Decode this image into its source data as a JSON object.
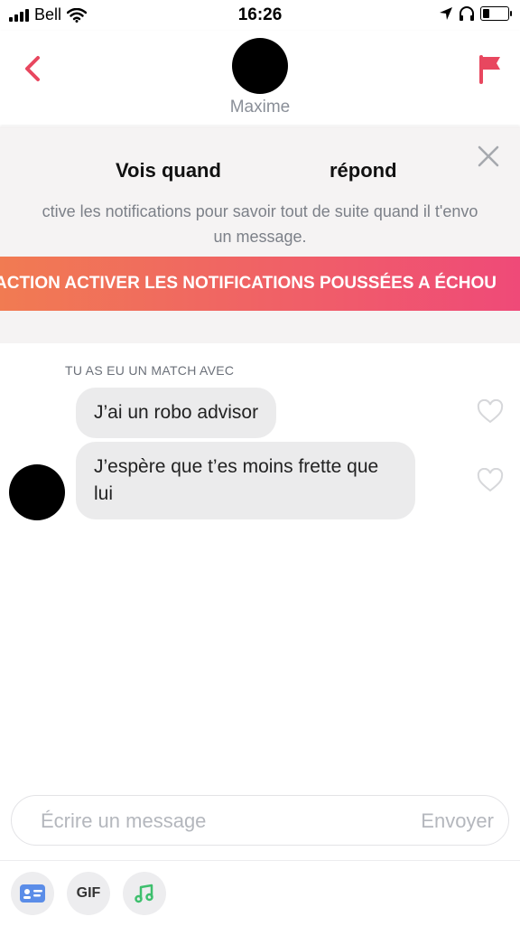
{
  "status_bar": {
    "carrier": "Bell",
    "time": "16:26"
  },
  "header": {
    "contact_name": "Maxime"
  },
  "banner": {
    "title_part1": "Vois quand",
    "title_part2": "répond",
    "description_line1": "ctive les notifications pour savoir tout de suite quand il t'envo",
    "description_line2": "un message.",
    "button_label": "ACTION ACTIVER LES NOTIFICATIONS POUSSÉES A ÉCHOU"
  },
  "chat": {
    "match_label": "TU AS EU UN MATCH AVEC",
    "messages": [
      {
        "text": "J’ai un robo advisor"
      },
      {
        "text": "J’espère que t’es moins frette que lui"
      }
    ]
  },
  "composer": {
    "placeholder": "Écrire un message",
    "send_label": "Envoyer"
  },
  "bottom_bar": {
    "gif_label": "GIF"
  },
  "colors": {
    "accent": "#e8475f",
    "gradient_start": "#f17b52",
    "gradient_end": "#ef4a78",
    "bubble": "#ebebec"
  }
}
